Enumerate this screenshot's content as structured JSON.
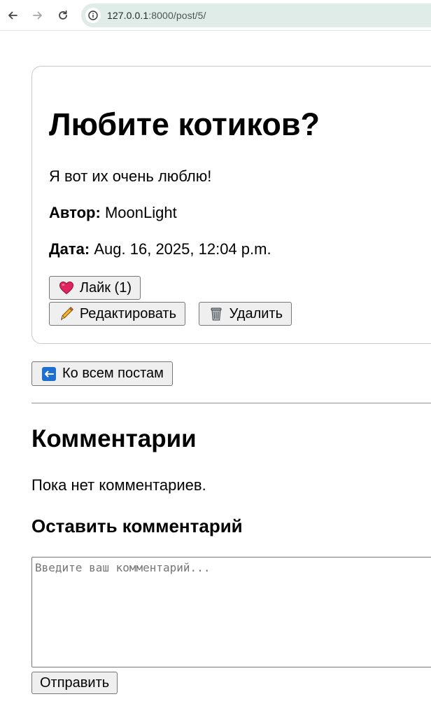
{
  "browser": {
    "url_host": "127.0.0.1",
    "url_path": ":8000/post/5/",
    "icons": {
      "back": "arrow-left-icon",
      "forward": "arrow-right-icon",
      "reload": "reload-icon",
      "site_info": "site-info-icon"
    }
  },
  "post": {
    "title": "Любите котиков?",
    "body": "Я вот их очень люблю!",
    "author_label": "Автор:",
    "author": "MoonLight",
    "date_label": "Дата:",
    "date": "Aug. 16, 2025, 12:04 p.m.",
    "like_label": "Лайк (1)",
    "edit_label": "Редактировать",
    "delete_label": "Удалить",
    "icons": {
      "like": "heart-icon",
      "edit": "pencil-icon",
      "delete": "trash-can-icon"
    }
  },
  "navigation": {
    "back_to_posts_label": "Ко всем постам",
    "back_icon": "left-arrow-box-icon"
  },
  "comments": {
    "title": "Комментарии",
    "empty_text": "Пока нет комментариев.",
    "form_title": "Оставить комментарий",
    "input_placeholder": "Введите ваш комментарий...",
    "input_value": "",
    "submit_label": "Отправить"
  },
  "colors": {
    "address_bar": "#dfece7",
    "button_bg": "#efefef",
    "heart": "#e0245e",
    "back_icon_bg": "#1e6fd0"
  }
}
